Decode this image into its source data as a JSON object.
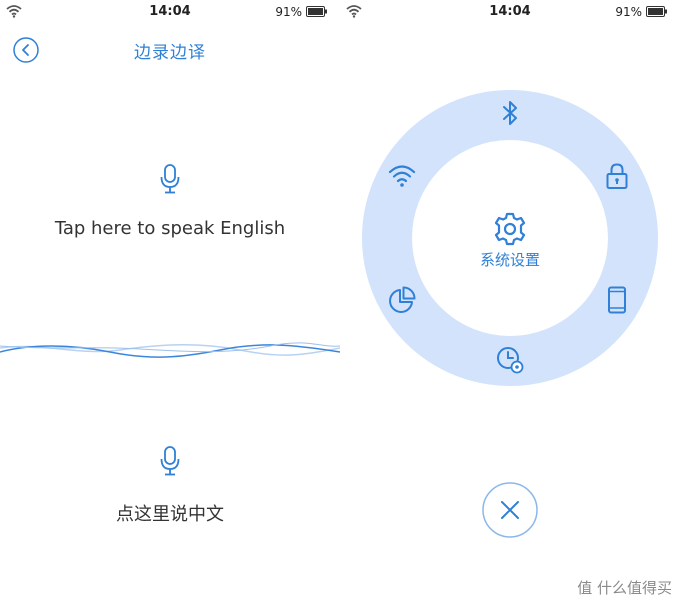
{
  "colors": {
    "accent": "#2f80d6",
    "ring": "#d2e3fb",
    "wave_dark": "#3b86dc",
    "wave_light": "#b7d2f3"
  },
  "left_screen": {
    "status_bar": {
      "time": "14:04",
      "battery": "91%"
    },
    "header": {
      "title": "边录边译",
      "back_icon": "chevron-left-icon"
    },
    "english": {
      "icon": "microphone-icon",
      "label": "Tap here to speak English"
    },
    "chinese": {
      "icon": "microphone-icon",
      "label": "点这里说中文"
    }
  },
  "right_screen": {
    "status_bar": {
      "time": "14:04",
      "battery": "91%"
    },
    "settings_menu": {
      "center_label": "系统设置",
      "items": [
        {
          "icon": "bluetooth-icon"
        },
        {
          "icon": "lock-icon"
        },
        {
          "icon": "phone-icon"
        },
        {
          "icon": "clock-settings-icon"
        },
        {
          "icon": "pie-chart-icon"
        },
        {
          "icon": "wifi-icon"
        }
      ]
    },
    "close_icon": "close-icon"
  },
  "watermark": {
    "text": "值 什么值得买"
  }
}
